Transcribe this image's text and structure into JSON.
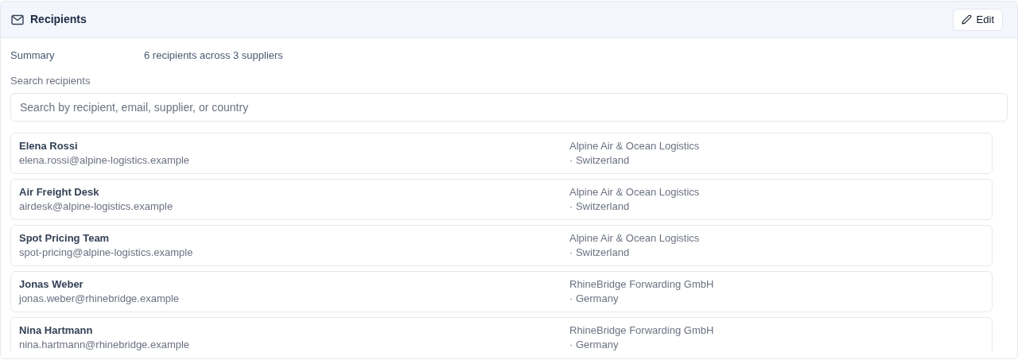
{
  "panel": {
    "title": "Recipients",
    "edit_button": "Edit"
  },
  "summary": {
    "label": "Summary",
    "value": "6 recipients across 3 suppliers"
  },
  "search": {
    "label": "Search recipients",
    "placeholder": "Search by recipient, email, supplier, or country"
  },
  "recipients": [
    {
      "name": "Elena Rossi",
      "email": "elena.rossi@alpine-logistics.example",
      "supplier": "Alpine Air & Ocean Logistics",
      "country": "· Switzerland"
    },
    {
      "name": "Air Freight Desk",
      "email": "airdesk@alpine-logistics.example",
      "supplier": "Alpine Air & Ocean Logistics",
      "country": "· Switzerland"
    },
    {
      "name": "Spot Pricing Team",
      "email": "spot-pricing@alpine-logistics.example",
      "supplier": "Alpine Air & Ocean Logistics",
      "country": "· Switzerland"
    },
    {
      "name": "Jonas Weber",
      "email": "jonas.weber@rhinebridge.example",
      "supplier": "RhineBridge Forwarding GmbH",
      "country": "· Germany"
    },
    {
      "name": "Nina Hartmann",
      "email": "nina.hartmann@rhinebridge.example",
      "supplier": "RhineBridge Forwarding GmbH",
      "country": "· Germany"
    }
  ]
}
